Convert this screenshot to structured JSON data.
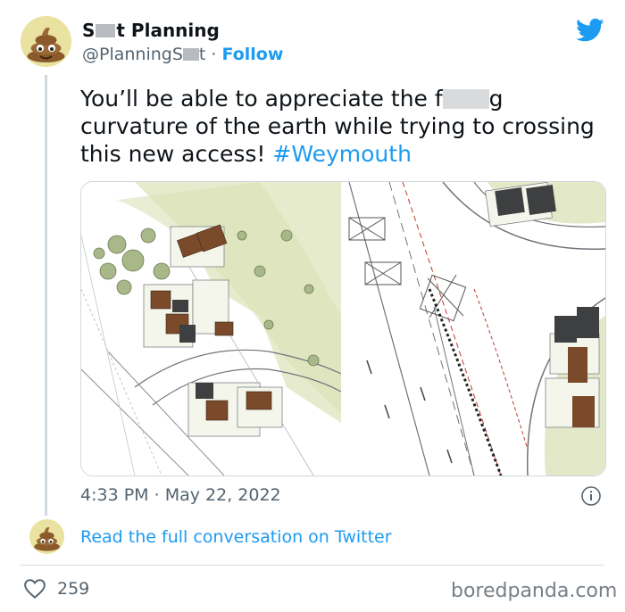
{
  "tweet": {
    "display_name_prefix": "S",
    "display_name_suffix": "t Planning",
    "handle_prefix": "@PlanningS",
    "handle_suffix": "t",
    "separator": "·",
    "follow_label": "Follow",
    "text_part1": "You’ll be able to appreciate the f",
    "text_part2": "g",
    "text_part3": "curvature of the earth while trying to crossing",
    "text_part4": "this new access!",
    "hashtag": "#Weymouth",
    "time": "4:33 PM",
    "date": "May 22, 2022"
  },
  "conversation": {
    "link_label": "Read the full conversation on Twitter"
  },
  "engagement": {
    "likes": "259"
  },
  "watermark": {
    "text": "boredpanda.com"
  },
  "icons": {
    "avatar": "poop-emoji-avatar",
    "platform": "twitter-bird-icon",
    "info": "info-icon",
    "like": "heart-icon"
  },
  "colors": {
    "accent": "#1d9bf0",
    "secondary_text": "#536471",
    "border": "#cfd9de",
    "map_green": "#dfe6c3"
  }
}
